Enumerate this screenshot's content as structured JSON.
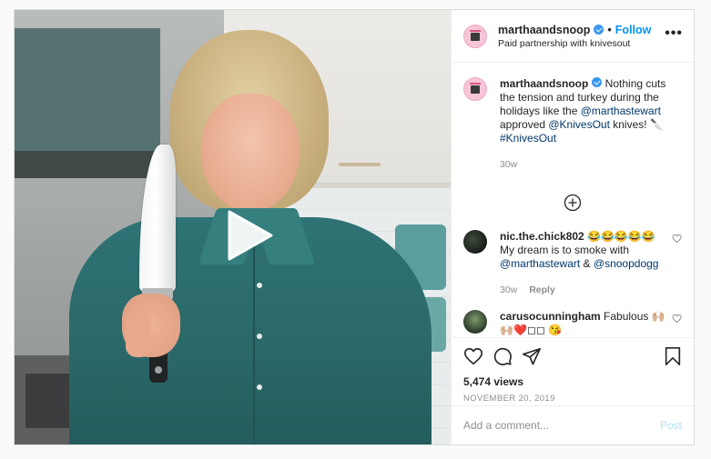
{
  "header": {
    "username": "marthaandsnoop",
    "follow_label": "Follow",
    "separator": "•",
    "subtitle": "Paid partnership with knivesout",
    "more_glyph": "•••"
  },
  "caption": {
    "username": "marthaandsnoop",
    "text_1": " Nothing cuts the tension and turkey during the holidays like the ",
    "mention_1": "@marthastewart",
    "text_2": " approved ",
    "mention_2": "@KnivesOut",
    "text_3": " knives! 🔪 ",
    "hashtag": "#KnivesOut",
    "time": "30w"
  },
  "comments": [
    {
      "username": "nic.the.chick802",
      "text_1": " 😂😂😂😂😂 My dream is to smoke with ",
      "mention_1": "@marthastewart",
      "text_2": " & ",
      "mention_2": "@snoopdogg",
      "time": "30w",
      "reply_label": "Reply"
    },
    {
      "username": "carusocunningham",
      "text": " Fabulous 🙌🏼 🙌🏼❤️◻◻  😘"
    }
  ],
  "stats": {
    "views": "5,474 views",
    "date": "NOVEMBER 20, 2019"
  },
  "composer": {
    "placeholder": "Add a comment...",
    "post_label": "Post"
  },
  "icons": {
    "verified": "verified-badge-icon",
    "more": "more-options-icon",
    "load_more": "plus-circle-icon",
    "like": "heart-icon",
    "comment": "comment-bubble-icon",
    "share": "paper-plane-icon",
    "save": "bookmark-icon",
    "play": "play-icon"
  },
  "colors": {
    "link": "#0095f6",
    "mention": "#00376b",
    "verified": "#3897f0",
    "post_disabled": "#b2dffc",
    "muted": "#8e8e8e"
  }
}
